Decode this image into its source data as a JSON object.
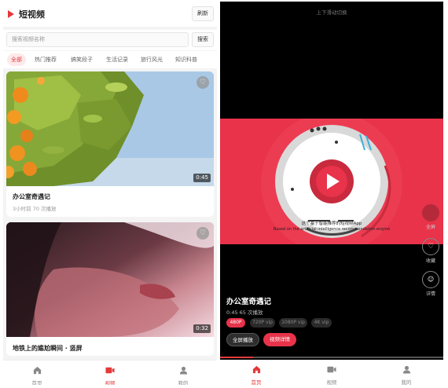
{
  "left": {
    "header": {
      "title": "短视频",
      "refresh_label": "刷新"
    },
    "search": {
      "placeholder": "搜索视频名称",
      "button_label": "搜索"
    },
    "tabs": [
      "全部",
      "热门推荐",
      "搞笑段子",
      "生活记录",
      "旅行风光",
      "知识科普"
    ],
    "active_tab": "全部",
    "cards": [
      {
        "title": "办公室奇遇记",
        "meta": "3小时前  70 次播放",
        "duration": "0:45"
      },
      {
        "title": "地铁上的尴尬瞬间 · 竖屏",
        "duration": "0:32"
      }
    ],
    "nav": [
      {
        "label": "首页",
        "icon": "home-icon",
        "active": false
      },
      {
        "label": "视频",
        "icon": "video-icon",
        "active": true
      },
      {
        "label": "我的",
        "icon": "user-icon",
        "active": false
      }
    ]
  },
  "right": {
    "hint": "上下滑动切换",
    "video_caption_cn": "这个基于智能推荐的短视频App",
    "video_caption_en": "Based on the artificial intelligence recommendation engine",
    "title": "办公室奇遇记",
    "meta": "0:45   65 次播放",
    "resolutions": [
      "480P",
      "720P vip",
      "1080P vip",
      "4K vip"
    ],
    "active_resolution": "480P",
    "fullscreen_button": "全屏播放",
    "details_button": "视频详情",
    "side_actions": [
      {
        "label": "全屏",
        "icon": "fullscreen-icon"
      },
      {
        "label": "收藏",
        "icon": "heart-icon"
      },
      {
        "label": "详情",
        "icon": "info-icon"
      }
    ],
    "nav": [
      {
        "label": "首页",
        "icon": "home-icon",
        "active": true
      },
      {
        "label": "视频",
        "icon": "video-icon",
        "active": false
      },
      {
        "label": "我的",
        "icon": "user-icon",
        "active": false
      }
    ]
  },
  "colors": {
    "accent": "#e33a3a",
    "video_bg": "#e8334a"
  }
}
